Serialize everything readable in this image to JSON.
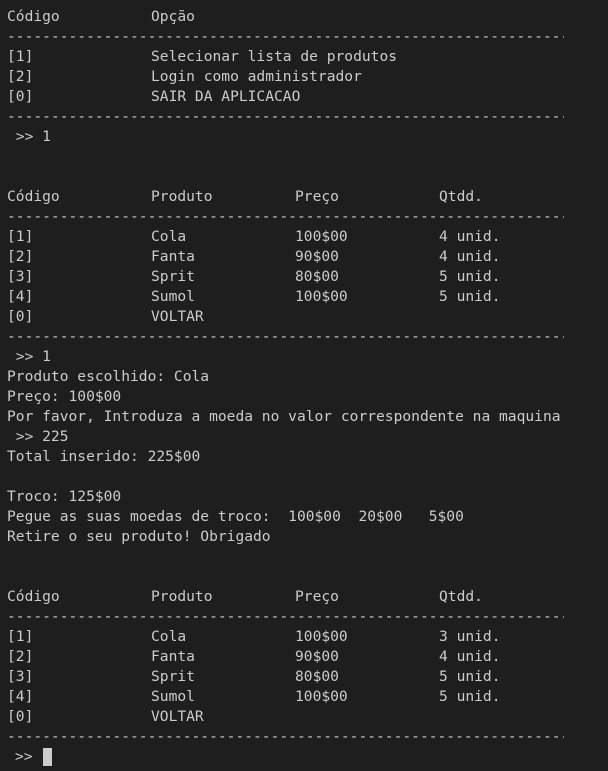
{
  "separator": "----------------------------------------------------------------------",
  "main_menu": {
    "header": [
      "Código",
      "Opção"
    ],
    "rows": [
      [
        "[1]",
        "Selecionar lista de produtos"
      ],
      [
        "[2]",
        "Login como administrador"
      ],
      [
        "[0]",
        "SAIR DA APLICACAO"
      ]
    ],
    "input": " >> 1"
  },
  "product_table_1": {
    "header": [
      "Código",
      "Produto",
      "Preço",
      "Qtdd."
    ],
    "rows": [
      [
        "[1]",
        "Cola",
        "100$00",
        "4 unid."
      ],
      [
        "[2]",
        "Fanta",
        "90$00",
        "4 unid."
      ],
      [
        "[3]",
        "Sprit",
        "80$00",
        "5 unid."
      ],
      [
        "[4]",
        "Sumol",
        "100$00",
        "5 unid."
      ],
      [
        "[0]",
        "VOLTAR",
        "",
        ""
      ]
    ],
    "input": " >> 1"
  },
  "purchase": {
    "lines": [
      "Produto escolhido: Cola",
      "Preço: 100$00",
      "Por favor, Introduza a moeda no valor correspondente na maquina",
      " >> 225",
      "Total inserido: 225$00",
      "",
      "Troco: 125$00",
      "Pegue as suas moedas de troco:  100$00  20$00   5$00",
      "Retire o seu produto! Obrigado"
    ]
  },
  "product_table_2": {
    "header": [
      "Código",
      "Produto",
      "Preço",
      "Qtdd."
    ],
    "rows": [
      [
        "[1]",
        "Cola",
        "100$00",
        "3 unid."
      ],
      [
        "[2]",
        "Fanta",
        "90$00",
        "4 unid."
      ],
      [
        "[3]",
        "Sprit",
        "80$00",
        "5 unid."
      ],
      [
        "[4]",
        "Sumol",
        "100$00",
        "5 unid."
      ],
      [
        "[0]",
        "VOLTAR",
        "",
        ""
      ]
    ],
    "prompt": ">>"
  }
}
